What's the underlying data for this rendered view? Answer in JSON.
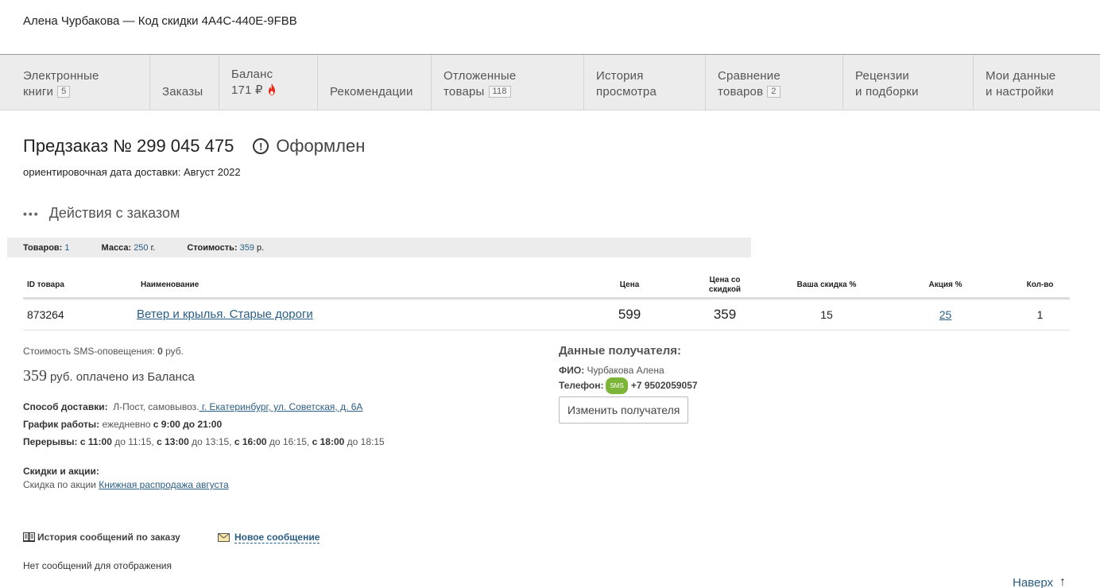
{
  "header": {
    "user_line": "Алена Чурбакова — Код скидки 4A4C-440E-9FBB"
  },
  "nav": {
    "ebooks": {
      "line1": "Электронные",
      "line2": "книги",
      "count": "5"
    },
    "orders": {
      "label": "Заказы"
    },
    "balance": {
      "label": "Баланс",
      "amount": "171 ₽"
    },
    "recommendations": {
      "label": "Рекомендации"
    },
    "deferred": {
      "line1": "Отложенные",
      "line2": "товары",
      "count": "118"
    },
    "history": {
      "line1": "История",
      "line2": "просмотра"
    },
    "compare": {
      "line1": "Сравнение",
      "line2": "товаров",
      "count": "2"
    },
    "reviews": {
      "line1": "Рецензии",
      "line2": "и подборки"
    },
    "settings": {
      "line1": "Мои данные",
      "line2": "и настройки"
    }
  },
  "order": {
    "title": "Предзаказ № 299 045 475",
    "status_icon": "!",
    "status": "Оформлен",
    "delivery_label": "ориентировочная дата доставки:",
    "delivery_value": "Август 2022",
    "actions_dots": "•••",
    "actions_label": "Действия с заказом"
  },
  "summary": {
    "goods_label": "Товаров:",
    "goods_value": "1",
    "mass_label": "Масса:",
    "mass_value": "250",
    "mass_unit": "г.",
    "cost_label": "Стоимость:",
    "cost_value": "359",
    "cost_unit": "р."
  },
  "table": {
    "headers": {
      "id": "ID товара",
      "name": "Наименование",
      "price": "Цена",
      "discount_price_1": "Цена со",
      "discount_price_2": "скидкой",
      "your_discount": "Ваша скидка %",
      "promo": "Акция %",
      "qty": "Кол-во"
    },
    "rows": [
      {
        "id": "873264",
        "name": "Ветер и крылья. Старые дороги",
        "price": "599",
        "discount_price": "359",
        "your_discount": "15",
        "promo": "25",
        "qty": "1"
      }
    ]
  },
  "payment": {
    "sms_label": "Стоимость SMS-оповещения:",
    "sms_value": "0",
    "sms_unit": "руб.",
    "paid_amount": "359",
    "paid_text": "руб. оплачено из Баланса"
  },
  "delivery": {
    "method_label": "Способ доставки:",
    "method_value": "Л-Пост, самовывоз.",
    "address": " г. Екатеринбург, ул. Советская, д. 6А",
    "schedule_label": "График работы:",
    "schedule_text": "ежедневно",
    "schedule_value": "с 9:00 до 21:00",
    "breaks_label": "Перерывы:",
    "breaks": [
      {
        "from": "с 11:00",
        "to": "до 11:15,"
      },
      {
        "from": "с 13:00",
        "to": "до 13:15,"
      },
      {
        "from": "с 16:00",
        "to": "до 16:15,"
      },
      {
        "from": "с 18:00",
        "to": "до 18:15"
      }
    ]
  },
  "discounts": {
    "label": "Скидки и акции:",
    "text": "Скидка по акции",
    "link": "Книжная распродажа августа"
  },
  "recipient": {
    "title": "Данные получателя:",
    "name_label": "ФИО:",
    "name_value": "Чурбакова Алена",
    "phone_label": "Телефон:",
    "sms_badge": "SMS",
    "phone_value": "+7 9502059057",
    "change_button": "Изменить получателя"
  },
  "messages": {
    "history_label": "История сообщений по заказу",
    "new_label": "Новое сообщение",
    "empty_text": "Нет сообщений для отображения"
  },
  "footer": {
    "to_top": "Наверх",
    "arrow": "↑"
  },
  "colors": {
    "accent_link": "#2a5e84",
    "nav_bg": "#ececec",
    "sms_green": "#7db539",
    "flame": "#e8291c"
  }
}
